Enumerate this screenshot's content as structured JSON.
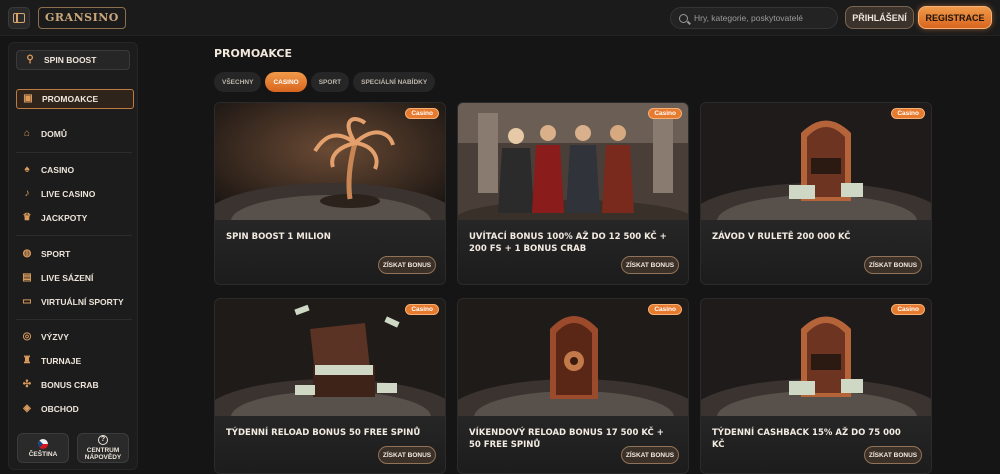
{
  "header": {
    "logo_text": "GRANSINO",
    "search_placeholder": "Hry, kategorie, poskytovatelé",
    "login_label": "PŘIHLÁŠENÍ",
    "register_label": "REGISTRACE"
  },
  "sidebar": {
    "spin_boost": "SPIN BOOST",
    "promo": "PROMOAKCE",
    "items": [
      {
        "label": "DOMŮ",
        "icon": "home-icon"
      },
      {
        "label": "CASINO",
        "icon": "casino-icon"
      },
      {
        "label": "LIVE CASINO",
        "icon": "microphone-icon"
      },
      {
        "label": "JACKPOTY",
        "icon": "jackpot-icon"
      },
      {
        "label": "SPORT",
        "icon": "ball-icon"
      },
      {
        "label": "LIVE SÁZENÍ",
        "icon": "live-icon"
      },
      {
        "label": "VIRTUÁLNÍ SPORTY",
        "icon": "monitor-icon"
      },
      {
        "label": "VÝZVY",
        "icon": "target-icon"
      },
      {
        "label": "TURNAJE",
        "icon": "trophy-icon"
      },
      {
        "label": "BONUS CRAB",
        "icon": "crab-icon"
      },
      {
        "label": "OBCHOD",
        "icon": "shop-icon"
      }
    ],
    "language_label": "ČEŠTINA",
    "help_label_1": "CENTRUM",
    "help_label_2": "NÁPOVĚDY"
  },
  "main": {
    "title": "PROMOAKCE",
    "tabs": [
      "VŠECHNY",
      "CASINO",
      "SPORT",
      "SPECIÁLNÍ NABÍDKY"
    ],
    "active_tab": "CASINO",
    "cards": [
      {
        "badge": "Casino",
        "title": "SPIN BOOST 1 MILION",
        "button": "ZÍSKAT BONUS",
        "scene": "palm"
      },
      {
        "badge": "Casino",
        "title": "UVÍTACÍ BONUS 100% AŽ DO 12 500 KČ + 200 FS + 1 BONUS CRAB",
        "button": "ZÍSKAT BONUS",
        "scene": "people"
      },
      {
        "badge": "Casino",
        "title": "ZÁVOD V RULETĚ 200 000 KČ",
        "button": "ZÍSKAT BONUS",
        "scene": "machine"
      },
      {
        "badge": "Casino",
        "title": "TÝDENNÍ RELOAD BONUS 50 FREE SPINŮ",
        "button": "ZÍSKAT BONUS",
        "scene": "chest"
      },
      {
        "badge": "Casino",
        "title": "VÍKENDOVÝ RELOAD BONUS 17 500 KČ + 50 FREE SPINŮ",
        "button": "ZÍSKAT BONUS",
        "scene": "safe"
      },
      {
        "badge": "Casino",
        "title": "TÝDENNÍ CASHBACK 15% AŽ DO 75 000 KČ",
        "button": "ZÍSKAT BONUS",
        "scene": "machine"
      }
    ]
  }
}
